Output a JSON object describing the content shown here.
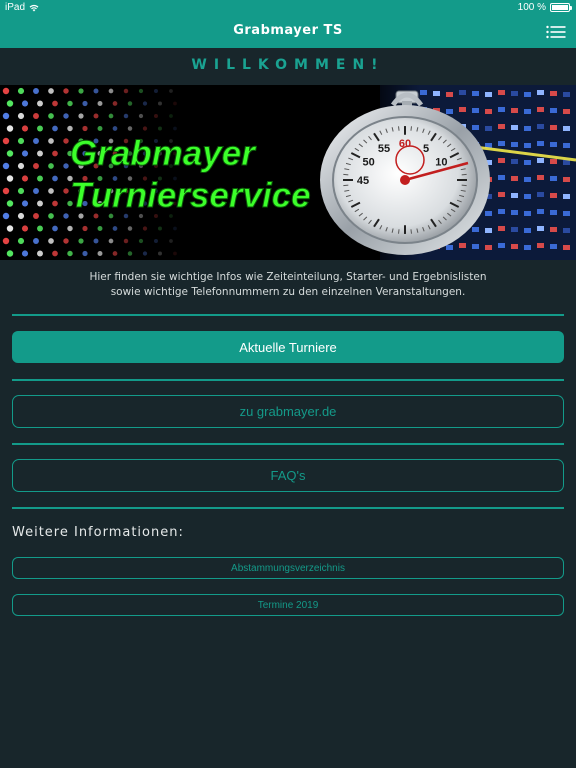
{
  "status": {
    "device": "iPad",
    "time": "",
    "battery": "100 %",
    "battery_level": 1.0
  },
  "header": {
    "title": "Grabmayer TS",
    "menu_icon": "menu-list-icon"
  },
  "main": {
    "welcome": "WILLKOMMEN!",
    "banner": {
      "line1": "Grabmayer",
      "line2": "Turnierservice",
      "watch_numbers": [
        "60",
        "5",
        "10",
        "55",
        "50",
        "45"
      ]
    },
    "intro_line1": "Hier finden sie wichtige Infos wie Zeiteinteilung, Starter- und Ergebnislisten",
    "intro_line2": "sowie wichtige Telefonnummern zu den einzelnen Veranstaltungen.",
    "buttons": {
      "current_tournaments": "Aktuelle Turniere",
      "website": "zu grabmayer.de",
      "faq": "FAQ's"
    },
    "more_info_title": "Weitere Informationen:",
    "links": {
      "pedigree": "Abstammungsverzeichnis",
      "dates": "Termine 2019"
    }
  },
  "colors": {
    "accent": "#139b8a",
    "background": "#18262b",
    "banner_text": "#3cff2a"
  }
}
